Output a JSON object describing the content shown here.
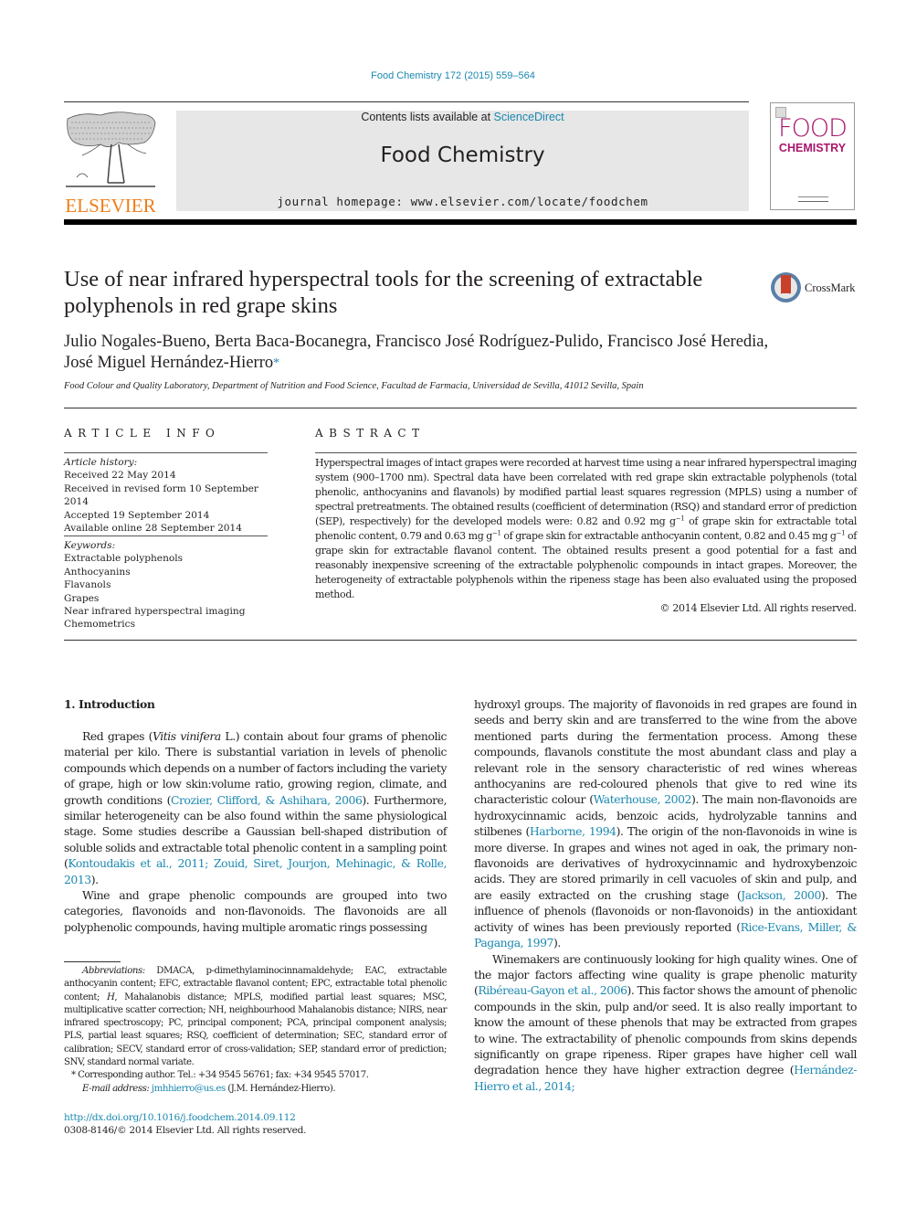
{
  "header": {
    "citation": "Food Chemistry 172 (2015) 559–564",
    "contents_prefix": "Contents lists available at ",
    "contents_link": "ScienceDirect",
    "journal_title": "Food Chemistry",
    "homepage_prefix": "journal homepage: ",
    "homepage_url": "www.elsevier.com/locate/foodchem",
    "publisher_logo": "ELSEVIER",
    "cover": {
      "line1": "FOOD",
      "line2": "CHEMISTRY"
    },
    "colors": {
      "link": "#1b88b0",
      "elsevier": "#f07d1a",
      "cover": "#a8176b"
    }
  },
  "article": {
    "title": "Use of near infrared hyperspectral tools for the screening of extractable polyphenols in red grape skins",
    "crossmark_label": "CrossMark",
    "authors_line1": "Julio Nogales-Bueno, Berta Baca-Bocanegra, Francisco José Rodríguez-Pulido, Francisco José Heredia,",
    "authors_line2": "José Miguel Hernández-Hierro",
    "corresponding_mark": "*",
    "affiliation": "Food Colour and Quality Laboratory, Department of Nutrition and Food Science, Facultad de Farmacia, Universidad de Sevilla, 41012 Sevilla, Spain"
  },
  "article_info": {
    "heading": "ARTICLE INFO",
    "history_label": "Article history:",
    "history": [
      "Received 22 May 2014",
      "Received in revised form 10 September 2014",
      "Accepted 19 September 2014",
      "Available online 28 September 2014"
    ],
    "keywords_label": "Keywords:",
    "keywords": [
      "Extractable polyphenols",
      "Anthocyanins",
      "Flavanols",
      "Grapes",
      "Near infrared hyperspectral imaging",
      "Chemometrics"
    ]
  },
  "abstract": {
    "heading": "ABSTRACT",
    "p1": "Hyperspectral images of intact grapes were recorded at harvest time using a near infrared hyperspectral imaging system (900–1700 nm). Spectral data have been correlated with red grape skin extractable polyphenols (total phenolic, anthocyanins and flavanols) by modified partial least squares regression (MPLS) using a number of spectral pretreatments. The obtained results (coefficient of determination (RSQ) and standard error of prediction (SEP), respectively) for the developed models were: 0.82 and 0.92 mg g",
    "p2": " of grape skin for extractable total phenolic content, 0.79 and 0.63 mg g",
    "p3": " of grape skin for extractable anthocyanin content, 0.82 and 0.45 mg g",
    "p4": " of grape skin for extractable flavanol content. The obtained results present a good potential for a fast and reasonably inexpensive screening of the extractable polyphenolic compounds in intact grapes. Moreover, the heterogeneity of extractable polyphenols within the ripeness stage has been also evaluated using the proposed method.",
    "sup": "−1",
    "copyright": "© 2014 Elsevier Ltd. All rights reserved."
  },
  "body": {
    "intro_heading": "1. Introduction",
    "left": {
      "p1_a": "Red grapes (",
      "p1_italic": "Vitis vinifera",
      "p1_b": " L.) contain about four grams of phenolic material per kilo. There is substantial variation in levels of phenolic compounds which depends on a number of factors including the variety of grape, high or low skin:volume ratio, growing region, climate, and growth conditions (",
      "p1_ref1": "Crozier, Clifford, & Ashihara, 2006",
      "p1_c": "). Furthermore, similar heterogeneity can be also found within the same physiological stage. Some studies describe a Gaussian bell-shaped distribution of soluble solids and extractable total phenolic content in a sampling point (",
      "p1_ref2": "Kontoudakis et al., 2011; Zouid, Siret, Jourjon, Mehinagic, & Rolle, 2013",
      "p1_d": ").",
      "p2": "Wine and grape phenolic compounds are grouped into two categories, flavonoids and non-flavonoids. The flavonoids are all polyphenolic compounds, having multiple aromatic rings possessing"
    },
    "right": {
      "p1_a": "hydroxyl groups. The majority of flavonoids in red grapes are found in seeds and berry skin and are transferred to the wine from the above mentioned parts during the fermentation process. Among these compounds, flavanols constitute the most abundant class and play a relevant role in the sensory characteristic of red wines whereas anthocyanins are red-coloured phenols that give to red wine its characteristic colour (",
      "p1_ref1": "Waterhouse, 2002",
      "p1_b": "). The main non-flavonoids are hydroxycinnamic acids, benzoic acids, hydrolyzable tannins and stilbenes (",
      "p1_ref2": "Harborne, 1994",
      "p1_c": "). The origin of the non-flavonoids in wine is more diverse. In grapes and wines not aged in oak, the primary non-flavonoids are derivatives of hydroxycinnamic and hydroxybenzoic acids. They are stored primarily in cell vacuoles of skin and pulp, and are easily extracted on the crushing stage (",
      "p1_ref3": "Jackson, 2000",
      "p1_d": "). The influence of phenols (flavonoids or non-flavonoids) in the antioxidant activity of wines has been previously reported (",
      "p1_ref4": "Rice-Evans, Miller, & Paganga, 1997",
      "p1_e": ").",
      "p2_a": "Winemakers are continuously looking for high quality wines. One of the major factors affecting wine quality is grape phenolic maturity (",
      "p2_ref1": "Ribéreau-Gayon et al., 2006",
      "p2_b": "). This factor shows the amount of phenolic compounds in the skin, pulp and/or seed. It is also really important to know the amount of these phenols that may be extracted from grapes to wine. The extractability of phenolic compounds from skins depends significantly on grape ripeness. Riper grapes have higher cell wall degradation hence they have higher extraction degree (",
      "p2_ref2": "Hernández-Hierro et al., 2014;"
    }
  },
  "footnotes": {
    "abbrev_label": "Abbreviations:",
    "abbrev_a": " DMACA, p-dimethylaminocinnamaldehyde; EAC, extractable anthocyanin content; EFC, extractable flavanol content; EPC, extractable total phenolic content; ",
    "abbrev_h": "H",
    "abbrev_b": ", Mahalanobis distance; MPLS, modified partial least squares; MSC, multiplicative scatter correction; NH, neighbourhood Mahalanobis distance; NIRS, near infrared spectroscopy; PC, principal component; PCA, principal component analysis; PLS, partial least squares; RSQ, coefficient of determination; SEC, standard error of calibration; SECV, standard error of cross-validation; SEP, standard error of prediction; SNV, standard normal variate.",
    "corresponding": "* Corresponding author. Tel.: +34 9545 56761; fax: +34 9545 57017.",
    "email_label": "E-mail address:",
    "email": "jmhhierro@us.es",
    "email_suffix": " (J.M. Hernández-Hierro).",
    "doi": "http://dx.doi.org/10.1016/j.foodchem.2014.09.112",
    "issn": "0308-8146/© 2014 Elsevier Ltd. All rights reserved."
  }
}
